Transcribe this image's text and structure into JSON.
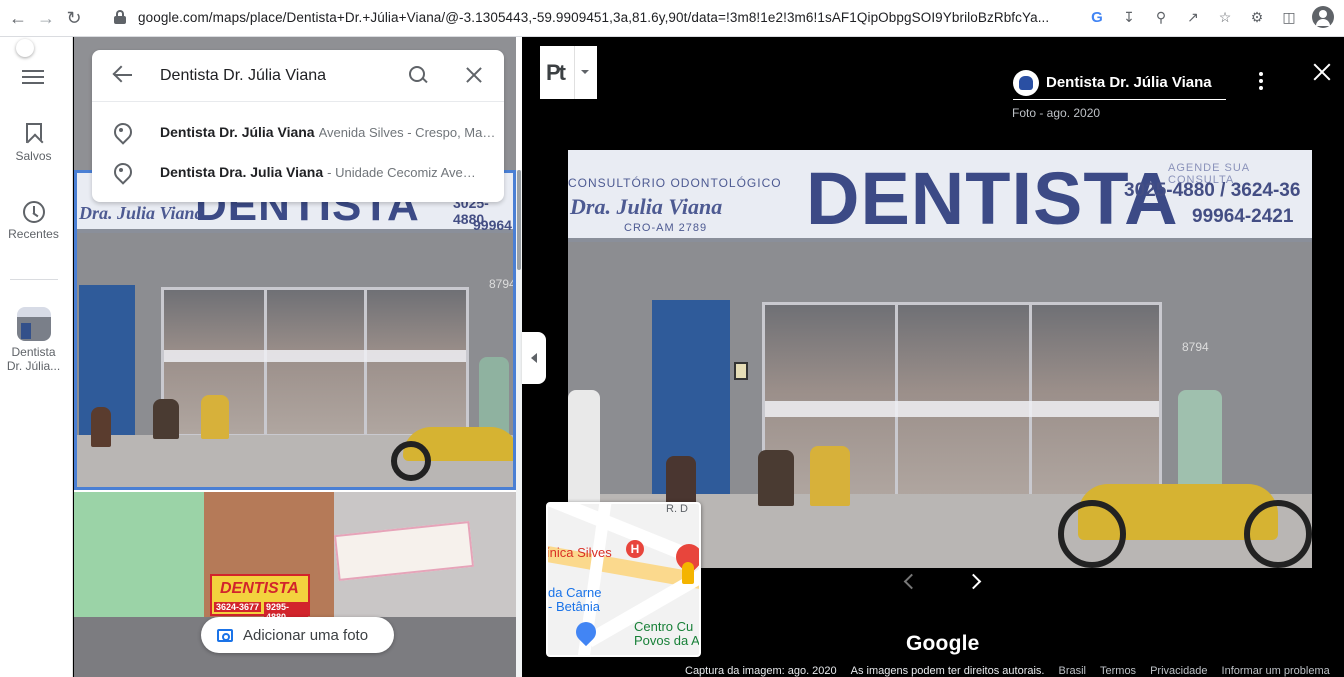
{
  "browser": {
    "url": "google.com/maps/place/Dentista+Dr.+Júlia+Viana/@-3.1305443,-59.9909451,3a,81.6y,90t/data=!3m8!1e2!3m6!1sAF1QipObpgSOI9YbriloBzRbfcYa..."
  },
  "rail": {
    "saved_label": "Salvos",
    "recent_label": "Recentes",
    "recent_place": "Dentista Dr. Júlia..."
  },
  "search": {
    "value": "Dentista Dr. Júlia Viana",
    "suggestions": [
      {
        "name": "Dentista Dr. Júlia Viana",
        "address": "Avenida Silves - Crespo, Manaus"
      },
      {
        "name": "Dentista Dra. Julia Viana",
        "address": "- Unidade Cecomiz Avenida"
      }
    ]
  },
  "panel": {
    "add_photo_label": "Adicionar uma foto"
  },
  "shopfront": {
    "sign_big": "DENTISTA",
    "sign_sub": "CONSULTÓRIO ODONTOLÓGICO",
    "sign_doctor": "Dra. Julia Viana",
    "sign_cro": "CRO-AM 2789",
    "sign_agende": "AGENDE SUA CONSULTA",
    "sign_phone1": "3025-4880 / 3624-36",
    "sign_phone2": "99964-2421",
    "small_phone1": "3025-4880",
    "small_phone2": "99964",
    "street_number": "8794",
    "banner_text": "DENTISTA",
    "banner_phone1": "3624-3677",
    "banner_phone2": "9295-4880"
  },
  "viewer": {
    "pt_label": "Pt",
    "place_name": "Dentista Dr. Júlia Viana",
    "photo_meta": "Foto - ago. 2020"
  },
  "minimap": {
    "label_clinic": "ínica Silves",
    "label_h": "H",
    "label_carne": "da Carne\n- Betânia",
    "label_centro": "Centro Cu\nPovos da A",
    "label_road": "R. D"
  },
  "footer": {
    "google": "Google",
    "capture": "Captura da imagem: ago. 2020",
    "rights": "As imagens podem ter direitos autorais.",
    "brasil": "Brasil",
    "termos": "Termos",
    "privacidade": "Privacidade",
    "report": "Informar um problema"
  }
}
